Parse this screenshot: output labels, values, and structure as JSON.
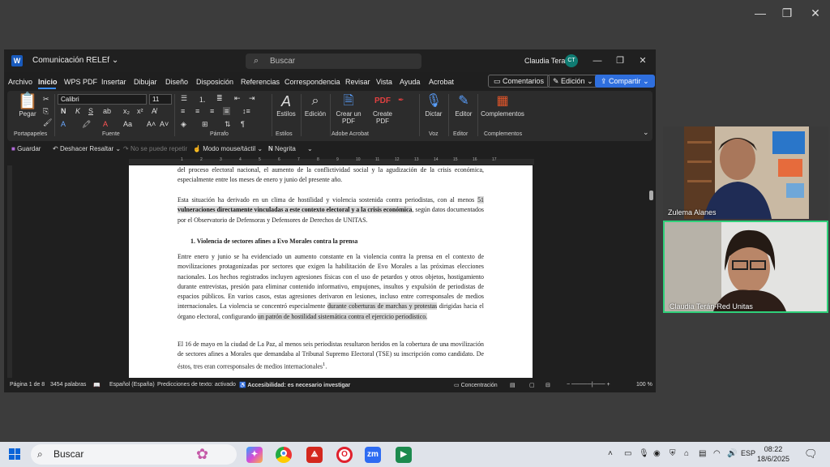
{
  "word": {
    "doc_title": "Comunicación RELEf",
    "search_placeholder": "Buscar",
    "user_name": "Claudia Teran",
    "user_initials": "CT",
    "menu": [
      "Archivo",
      "Inicio",
      "WPS PDF",
      "Insertar",
      "Dibujar",
      "Diseño",
      "Disposición",
      "Referencias",
      "Correspondencia",
      "Revisar",
      "Vista",
      "Ayuda",
      "Acrobat"
    ],
    "comments_label": "Comentarios",
    "edit_label": "Edición",
    "share_label": "Compartir",
    "ribbon": {
      "paste": "Pegar",
      "font_name": "Calibri",
      "font_size": "11",
      "styles": "Estilos",
      "editing": "Edición",
      "create_pdf": "Crear un PDF",
      "create_pdf2": "Create PDF",
      "dictate": "Dictar",
      "editor": "Editor",
      "addins": "Complementos",
      "groups": {
        "clipboard": "Portapapeles",
        "font": "Fuente",
        "paragraph": "Párrafo",
        "styles": "Estilos",
        "adobe": "Adobe Acrobat",
        "voice": "Voz",
        "editor": "Editor",
        "addins": "Complementos"
      }
    },
    "qat": {
      "save": "Guardar",
      "undo": "Deshacer Resaltar",
      "redo": "No se puede repetir",
      "mouse_mode": "Modo mouse/táctil",
      "bold": "Negrita"
    },
    "ruler_numbers": [
      "1",
      "2",
      "3",
      "4",
      "5",
      "6",
      "7",
      "8",
      "9",
      "10",
      "11",
      "12",
      "13",
      "14",
      "15",
      "16",
      "17"
    ],
    "page": {
      "p0": "del proceso electoral nacional, el aumento de la conflictividad social y la agudización de la crisis económica, especialmente entre los meses de enero y junio del presente año.",
      "p1a": "Esta situación ha derivado en un clima de hostilidad y violencia sostenida contra periodistas, con al menos",
      "p1b": "51",
      "p1c": "vulneraciones directamente vinculadas a este contexto electoral y a la crisis económica",
      "p1d": ", según datos documentados por el Observatorio de Defensoras y Defensores de Derechos de UNITAS.",
      "heading": "1.    Violencia de sectores afines a Evo Morales contra la prensa",
      "p2a": "Entre enero y junio se ha evidenciado un aumento constante en la violencia contra la prensa en el contexto de movilizaciones protagonizadas por sectores que exigen la habilitación de Evo Morales a las próximas elecciones nacionales. Los hechos registrados incluyen agresiones físicas con el uso de petardos y otros objetos, hostigamiento durante entrevistas, presión para eliminar contenido informativo, empujones, insultos y expulsión de periodistas de espacios públicos. En varios casos, estas agresiones derivaron en lesiones, incluso entre corresponsales de medios internacionales. La violencia se concentró especialmente",
      "p2b": "durante coberturas de marchas y protestas",
      "p2c": "dirigidas hacia el órgano electoral, configurando",
      "p2d": "un patrón de hostilidad sistemática contra el ejercicio periodístico.",
      "p3": "El 16 de mayo en la ciudad de La Paz, al menos seis periodistas resultaron heridos en la cobertura de una movilización de sectores afines a Morales que demandaba al Tribunal Supremo Electoral (TSE) su inscripción como candidato. De éstos, tres eran corresponsales de medios internacionales",
      "p3sup": "1",
      "p3end": "."
    },
    "status": {
      "page": "Página 1 de 8",
      "words": "3454 palabras",
      "language": "Español (España)",
      "predictions": "Predicciones de texto: activado",
      "accessibility": "Accesibilidad: es necesario investigar",
      "focus": "Concentración",
      "zoom": "100 %"
    }
  },
  "participants": [
    {
      "name": "Zulema Alanes"
    },
    {
      "name": "Claudia Terán-Red Unitas"
    }
  ],
  "taskbar": {
    "search": "Buscar",
    "lang": "ESP",
    "time": "08:22",
    "date": "18/6/2025"
  },
  "icons": [
    "windows-icon",
    "search-icon",
    "copilot-icon",
    "chrome-icon",
    "acrobat-icon",
    "opera-icon",
    "zoom-icon",
    "meet-icon",
    "notification-icon"
  ]
}
